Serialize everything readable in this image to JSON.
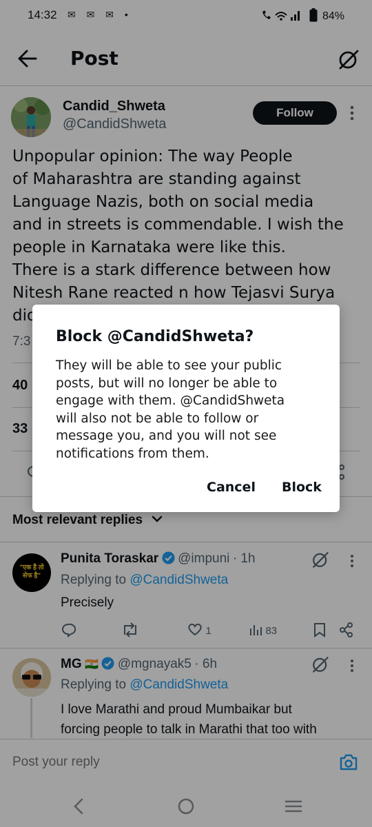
{
  "status_bar": {
    "time": "14:32",
    "notifications": "✉ ✉ ✉ •",
    "battery": "84%"
  },
  "header": {
    "title": "Post"
  },
  "post": {
    "author_name": "Candid_Shweta",
    "author_handle": "@CandidShweta",
    "follow_label": "Follow",
    "text_lines": [
      "Unpopular opinion: The way People",
      "of Maharashtra are standing against",
      "Language Nazis, both on social media",
      "and in streets is commendable. I wish the",
      "people in Karnataka were like this.",
      "There is a stark difference between how",
      "Nitesh Rane reacted n how Tejasvi Surya",
      "did"
    ],
    "time_fragment": "7:3",
    "stat_1_fragment": "40",
    "stat_2_fragment": "33"
  },
  "replies_sort": {
    "label": "Most relevant replies"
  },
  "replies": [
    {
      "name": "Punita Toraskar",
      "handle": "@impuni",
      "time": "· 1h",
      "replying_prefix": "Replying to",
      "replying_to": "@CandidShweta",
      "text": "Precisely",
      "avatar_text": "\"एक है तो सेफ है\"",
      "likes": "1",
      "views": "83"
    },
    {
      "name": "MG",
      "flag": "🇮🇳",
      "handle": "@mgnayak5",
      "time": "· 6h",
      "replying_prefix": "Replying to",
      "replying_to": "@CandidShweta",
      "text_lines": [
        "I love Marathi and proud Mumbaikar but",
        "forcing people to talk in Marathi that too with"
      ]
    }
  ],
  "reply_bar": {
    "placeholder": "Post your reply"
  },
  "dialog": {
    "title": "Block @CandidShweta?",
    "body_lines": [
      "They will be able to see your public",
      "posts, but will no longer be able to",
      "engage with them. @CandidShweta",
      "will also not be able to follow or",
      "message you, and you will not see",
      "notifications from them."
    ],
    "cancel_label": "Cancel",
    "block_label": "Block"
  },
  "colors": {
    "accent": "#1d9bf0",
    "text": "#0f1419",
    "secondary": "#536471"
  }
}
